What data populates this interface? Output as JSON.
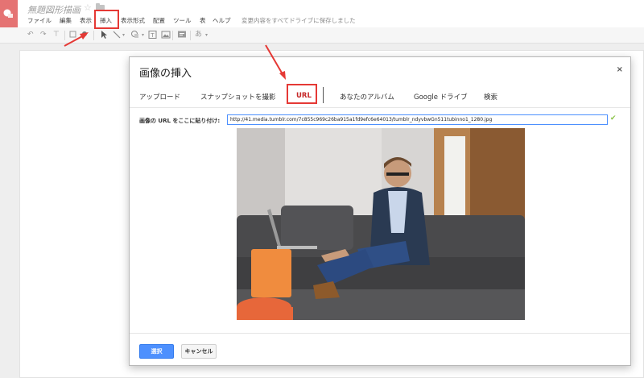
{
  "app": {
    "title": "無題図形描画",
    "save_status": "変更内容をすべてドライブに保存しました"
  },
  "menu": {
    "items": [
      "ファイル",
      "編集",
      "表示",
      "挿入",
      "表示形式",
      "配置",
      "ツール",
      "表",
      "ヘルプ"
    ]
  },
  "toolbar": {
    "text_style_label": "あ"
  },
  "dialog": {
    "title": "画像の挿入",
    "close_label": "×",
    "tabs": [
      "アップロード",
      "スナップショットを撮影",
      "URL",
      "あなたのアルバム",
      "Google ドライブ",
      "検索"
    ],
    "active_tab": "URL",
    "url_label": "画像の URL をここに貼り付け:",
    "url_value": "http://41.media.tumblr.com/7c855c969c26ba915a1fd9efc6e64013/tumblr_ndyvbwGn511tubinno1_1280.jpg",
    "select_button": "選択",
    "cancel_button": "キャンセル"
  },
  "colors": {
    "accent": "#4d90fe",
    "annotation": "#e53935",
    "logo": "#e57373"
  },
  "icons": [
    "app-logo-icon",
    "star-icon",
    "folder-icon",
    "undo-icon",
    "redo-icon",
    "paint-format-icon",
    "zoom-icon",
    "select-icon",
    "line-icon",
    "shape-icon",
    "textbox-icon",
    "image-icon",
    "comment-icon",
    "close-icon",
    "check-icon"
  ]
}
